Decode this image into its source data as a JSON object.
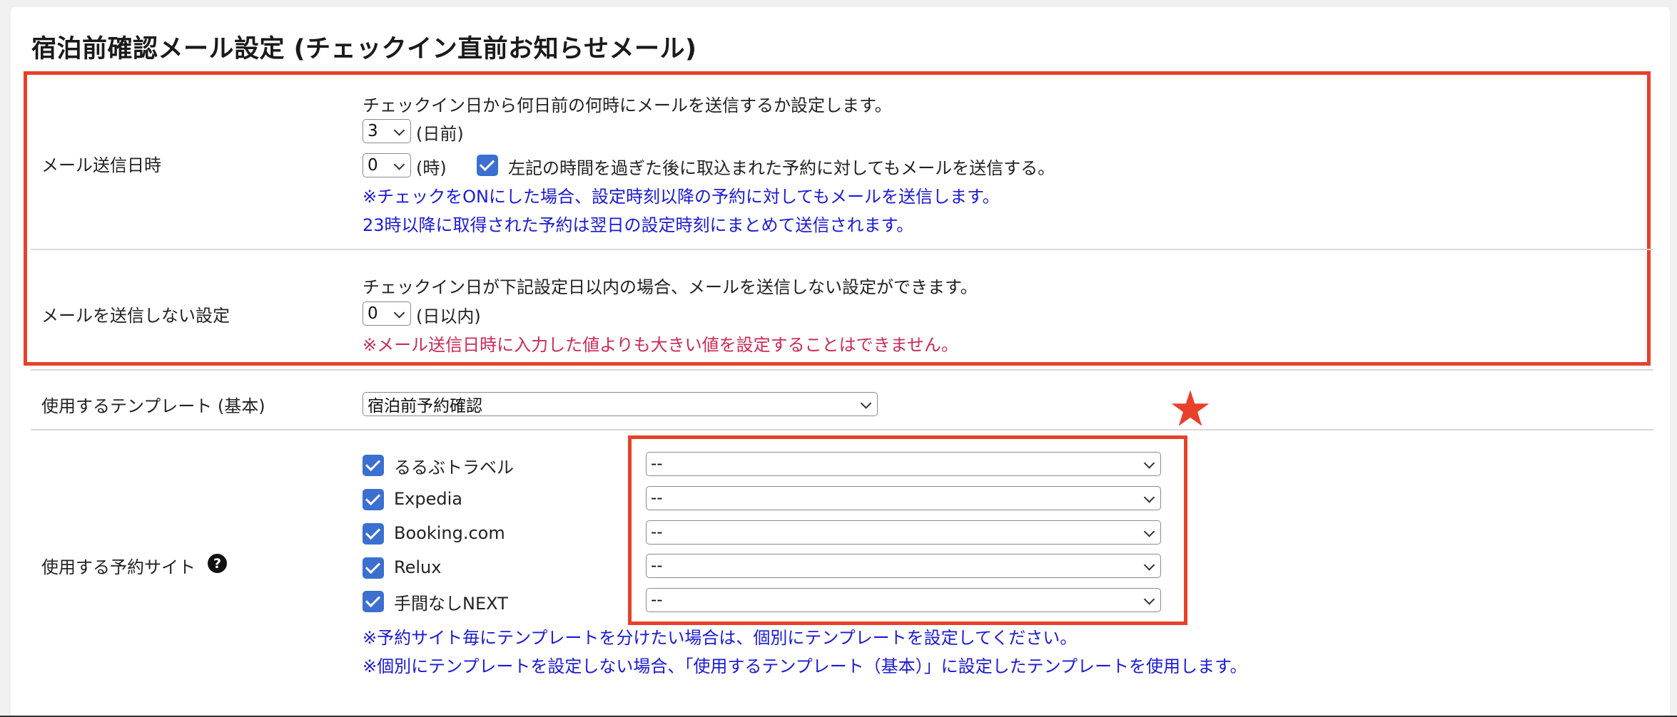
{
  "section_title": "宿泊前確認メール設定 (チェックイン直前お知らせメール)",
  "send_datetime": {
    "label": "メール送信日時",
    "description": "チェックイン日から何日前の何時にメールを送信するか設定します。",
    "days_value": "3",
    "days_suffix": "(日前)",
    "hour_value": "0",
    "hour_suffix": "(時)",
    "late_checkbox_checked": true,
    "late_checkbox_label": "左記の時間を過ぎた後に取込まれた予約に対してもメールを送信する。",
    "note1": "※チェックをONにした場合、設定時刻以降の予約に対してもメールを送信します。",
    "note2": "23時以降に取得された予約は翌日の設定時刻にまとめて送信されます。"
  },
  "no_send": {
    "label": "メールを送信しない設定",
    "description": "チェックイン日が下記設定日以内の場合、メールを送信しない設定ができます。",
    "days_value": "0",
    "days_suffix": "(日以内)",
    "warning": "※メール送信日時に入力した値よりも大きい値を設定することはできません。"
  },
  "template": {
    "label": "使用するテンプレート (基本)",
    "value": "宿泊前予約確認"
  },
  "sites": {
    "label": "使用する予約サイト",
    "help_icon_text": "?",
    "items": [
      {
        "name": "るるぶトラベル",
        "checked": true,
        "template": "--"
      },
      {
        "name": "Expedia",
        "checked": true,
        "template": "--"
      },
      {
        "name": "Booking.com",
        "checked": true,
        "template": "--"
      },
      {
        "name": "Relux",
        "checked": true,
        "template": "--"
      },
      {
        "name": "手間なしNEXT",
        "checked": true,
        "template": "--"
      }
    ],
    "note1": "※予約サイト毎にテンプレートを分けたい場合は、個別にテンプレートを設定してください。",
    "note2": "※個別にテンプレートを設定しない場合、「使用するテンプレート（基本）」に設定したテンプレートを使用します。"
  },
  "colors": {
    "highlight": "#e8402a",
    "checkbox": "#3b6fd0",
    "note_blue": "#1a1ad6",
    "warning_red": "#cc2a55"
  }
}
